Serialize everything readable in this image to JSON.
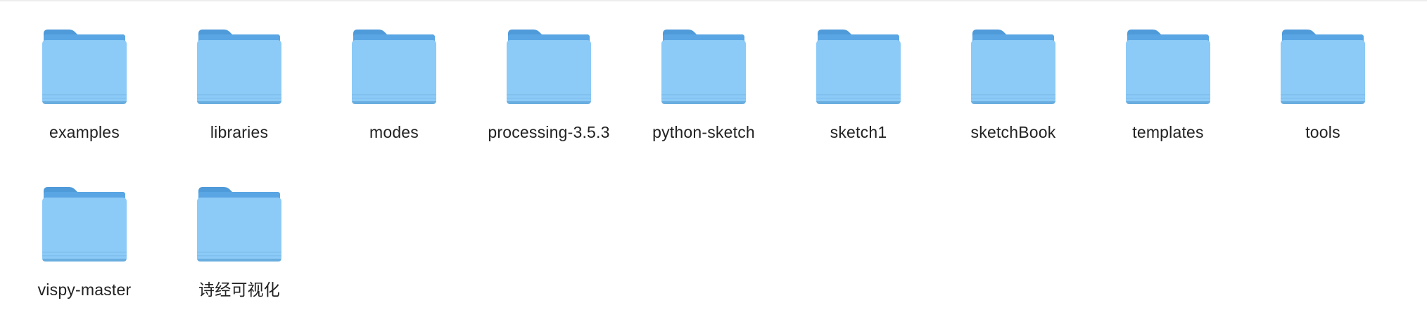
{
  "window": {
    "view": "icon-view",
    "background_color": "#ffffff"
  },
  "folder_style": {
    "icon_name": "folder-icon",
    "tab_color": "#4f9ad9",
    "back_color": "#5aa6e4",
    "front_color": "#8ccaf7",
    "shadow_color": "#6aaedf",
    "label_color": "#222222"
  },
  "folders": [
    {
      "name": "examples"
    },
    {
      "name": "libraries"
    },
    {
      "name": "modes"
    },
    {
      "name": "processing-3.5.3"
    },
    {
      "name": "python-sketch"
    },
    {
      "name": "sketch1"
    },
    {
      "name": "sketchBook"
    },
    {
      "name": "templates"
    },
    {
      "name": "tools"
    },
    {
      "name": "vispy-master"
    },
    {
      "name": "诗经可视化"
    }
  ]
}
